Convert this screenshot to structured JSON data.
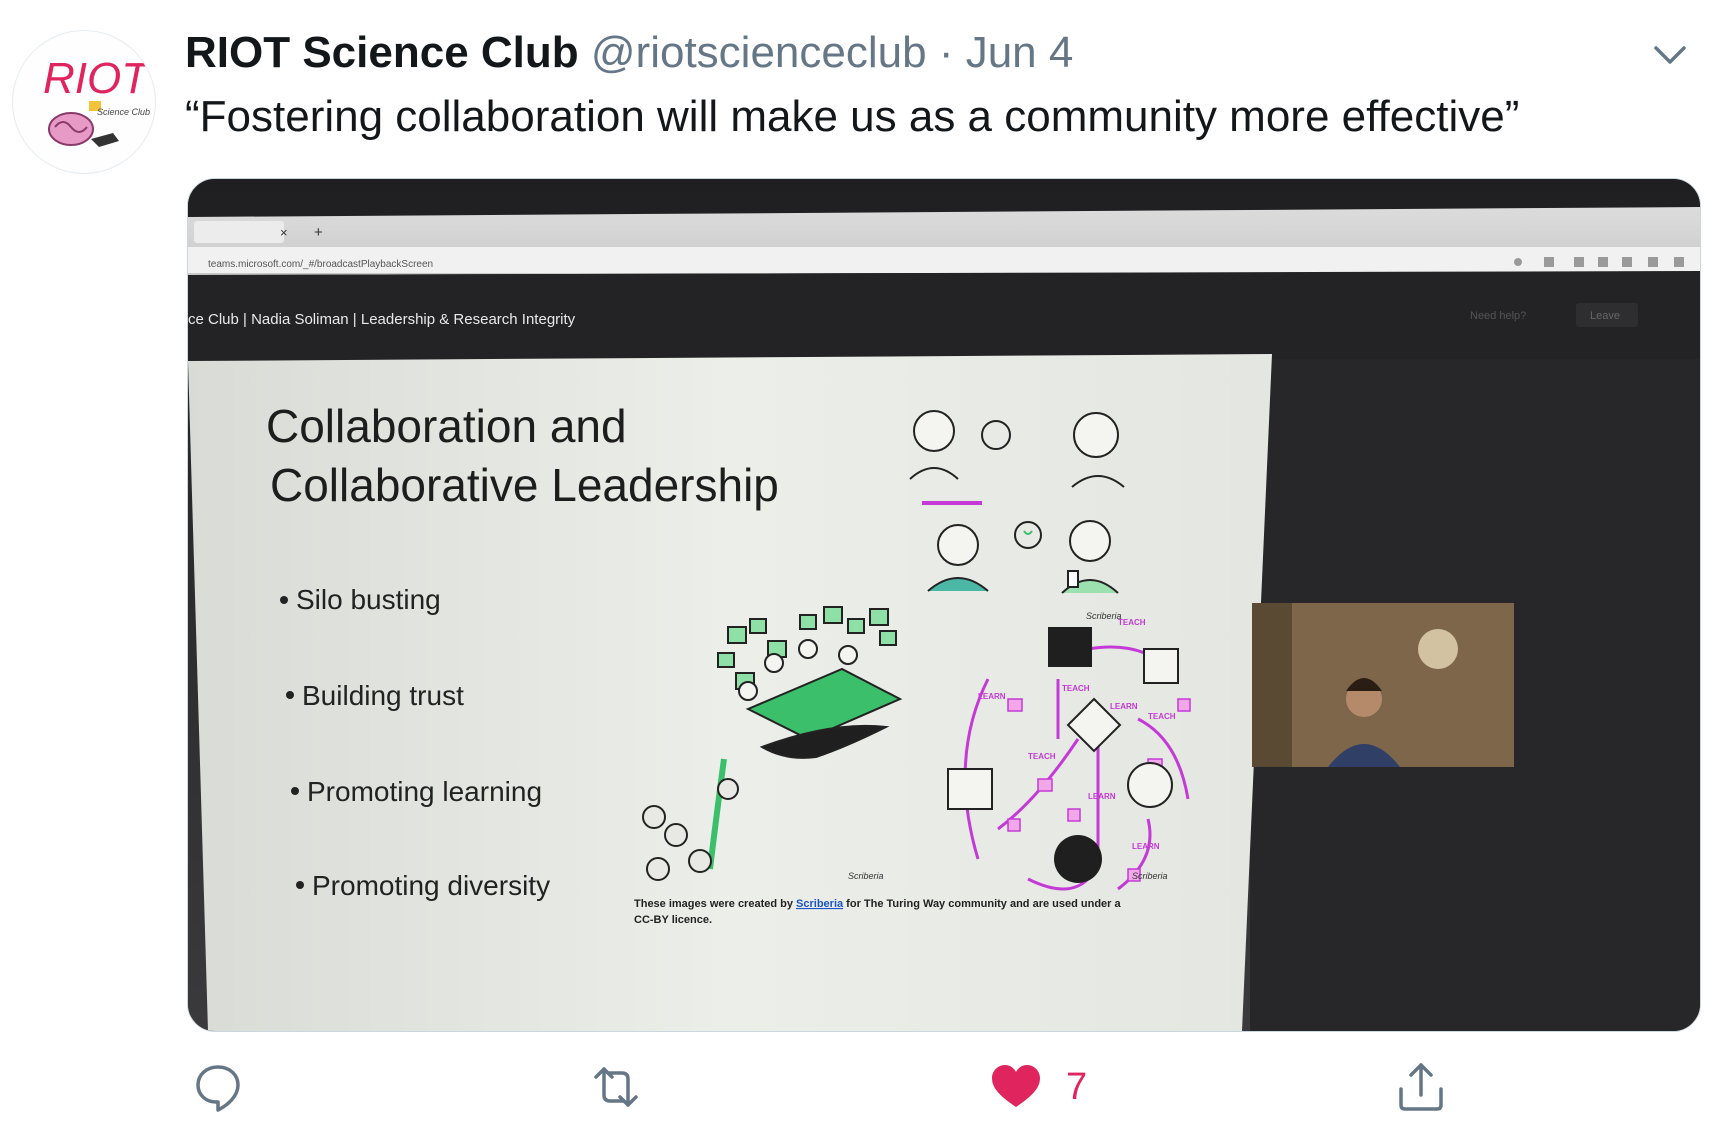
{
  "tweet": {
    "author_name": "RIOT Science Club",
    "handle": "@riotscienceclub",
    "separator": "·",
    "date": "Jun 4",
    "text": "“Fostering collaboration will make us as a community more effective”",
    "avatar_logo_text": "RIOT",
    "avatar_logo_subtext": "Science Club"
  },
  "screen": {
    "tab_close": "×",
    "tab_new": "+",
    "url": "teams.microsoft.com/_#/broadcastPlaybackScreen",
    "meeting_title": "ce Club | Nadia Soliman | Leadership & Research Integrity",
    "need_help": "Need help?",
    "leave_button": "Leave"
  },
  "slide": {
    "title_line1": "Collaboration and",
    "title_line2": "Collaborative Leadership",
    "bullets": [
      "Silo busting",
      "Building trust",
      "Promoting learning",
      "Promoting diversity"
    ],
    "credit_prefix": "These images were created by ",
    "credit_link": "Scriberia",
    "credit_suffix": " for The Turing Way community and are used under a",
    "credit_line2": "CC-BY licence.",
    "signature": "Scriberia",
    "map_labels": [
      "TEACH",
      "LEARN",
      "TEACH",
      "LEARN",
      "TEACH",
      "TEACH",
      "LEARN",
      "LEARN"
    ]
  },
  "actions": {
    "like_count": "7"
  },
  "colors": {
    "accent_pink": "#e0245e",
    "twitter_gray": "#657786",
    "illustration_green": "#3bbf6a",
    "illustration_magenta": "#c43ad6"
  },
  "icons": [
    "reply-icon",
    "retweet-icon",
    "like-icon",
    "share-icon",
    "chevron-down-icon"
  ]
}
